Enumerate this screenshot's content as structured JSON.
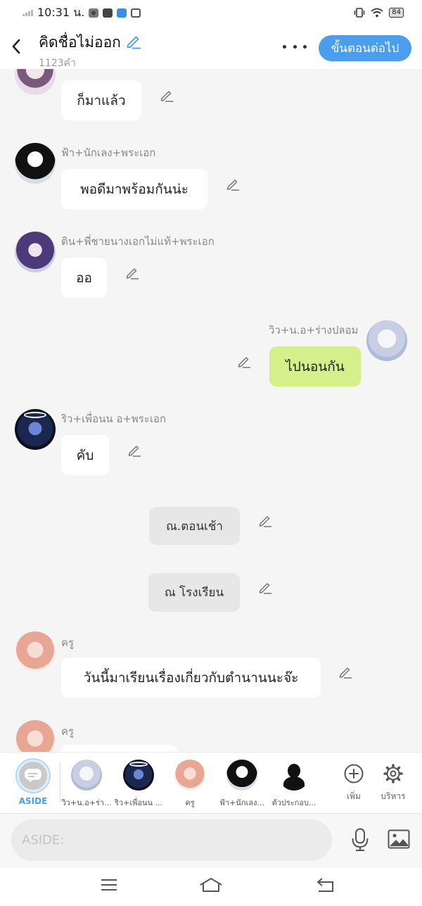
{
  "status_bar": {
    "time": "10:31 น.",
    "battery": "84"
  },
  "header": {
    "title": "คิดชื่อไม่ออก",
    "word_count": "1123คำ",
    "next_label": "ขั้นตอนต่อไป"
  },
  "messages": [
    {
      "text": "ก็มาแล้ว"
    },
    {
      "sender": "ฟ้า+นักเลง+พระเอก",
      "text": "พอดีมาพร้อมกันน่ะ"
    },
    {
      "sender": "ติน+พี่ชายนางเอกไม่แท้+พระเอก",
      "text": "ออ"
    },
    {
      "sender": "วิว+น.อ+ร่างปลอม",
      "text": "ไปนอนกัน"
    },
    {
      "sender": "ริว+เพื่อนน อ+พระเอก",
      "text": "คับ"
    },
    {
      "text": "ณ.ตอนเช้า"
    },
    {
      "text": "ณ โรงเรียน"
    },
    {
      "sender": "ครู",
      "text": "วันนี้มาเรียนเรื่องเกี่ยวกับตำนานนะจ๊ะ"
    },
    {
      "sender": "ครู"
    }
  ],
  "characters": [
    {
      "label": "ASIDE"
    },
    {
      "label": "วิว+น.อ+ร่า..."
    },
    {
      "label": "ริว+เพื่อนน ..."
    },
    {
      "label": "ครู"
    },
    {
      "label": "ฟ้า+นักเลง..."
    },
    {
      "label": "ตัวประกอบ..."
    },
    {
      "label": "เพิ่ม"
    },
    {
      "label": "บริหาร"
    }
  ],
  "input": {
    "placeholder": "ASIDE:"
  },
  "colors": {
    "accent": "#4a9eed",
    "my_bubble": "#d4f08a",
    "narration_bubble": "#e7e7e7"
  }
}
